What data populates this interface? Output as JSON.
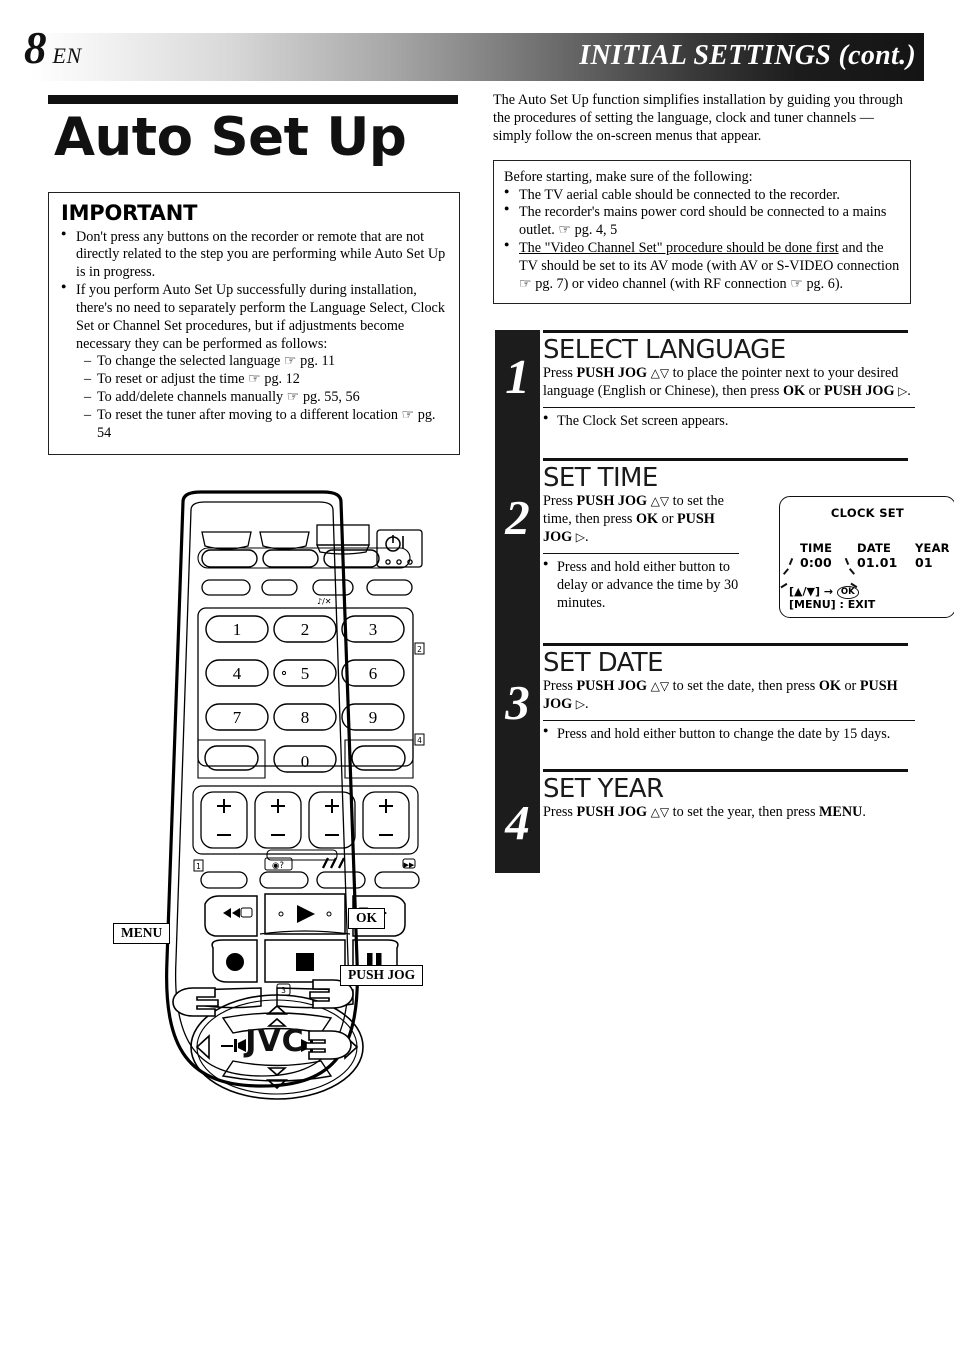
{
  "header": {
    "page_number": "8",
    "language_code": "EN",
    "title": "INITIAL SETTINGS (cont.)"
  },
  "left": {
    "doc_title": "Auto Set Up",
    "important": {
      "heading": "IMPORTANT",
      "bullets": [
        "Don't press any buttons on the recorder or remote that are not directly related to the step you are performing while Auto Set Up is in progress.",
        "If you perform Auto Set Up successfully during installation, there's no need to separately perform the Language Select, Clock Set or Channel Set procedures, but if adjustments become necessary they can be performed as follows:"
      ],
      "sub_items": [
        "To change the selected language ☞ pg. 11",
        "To reset or adjust the time ☞ pg. 12",
        "To add/delete channels manually ☞ pg. 55, 56",
        "To reset the tuner after moving to a different location ☞ pg. 54"
      ]
    },
    "remote": {
      "brand": "JVC",
      "callouts": {
        "menu": "MENU",
        "ok": "OK",
        "push_jog": "PUSH JOG"
      },
      "keypad": [
        "1",
        "2",
        "3",
        "4",
        "5",
        "6",
        "7",
        "8",
        "9",
        "0"
      ]
    }
  },
  "right": {
    "intro": "The Auto Set Up function simplifies installation by guiding you through the procedures of setting the language, clock and tuner channels — simply follow the on-screen menus that appear.",
    "before_box": {
      "lead": "Before starting, make sure of the following:",
      "bullets": [
        "The TV aerial cable should be connected to the recorder.",
        "The recorder's mains power cord should be connected to a mains outlet. ☞ pg. 4, 5",
        "The \"Video Channel Set\" procedure should be done first and the TV should be set to its AV mode (with AV or S-VIDEO connection ☞ pg. 7) or video channel (with RF connection ☞ pg. 6)."
      ],
      "underlined_phrase": "The \"Video Channel Set\" procedure should be done first"
    },
    "steps": [
      {
        "number": "1",
        "title": "SELECT LANGUAGE",
        "text": "Press PUSH JOG △▽ to place the pointer next to your desired language (English or Chinese), then press OK or PUSH JOG ▷.",
        "note": "The Clock Set screen appears."
      },
      {
        "number": "2",
        "title": "SET TIME",
        "text": "Press PUSH JOG △▽ to set the time, then press OK or PUSH JOG ▷.",
        "note": "Press and hold either button to delay or advance the time by 30 minutes."
      },
      {
        "number": "3",
        "title": "SET DATE",
        "text": "Press PUSH JOG △▽ to set the date, then press OK or PUSH JOG ▷.",
        "note": "Press and hold either button to change the date by 15 days."
      },
      {
        "number": "4",
        "title": "SET YEAR",
        "text": "Press PUSH JOG △▽ to set the year, then press MENU.",
        "note": ""
      }
    ],
    "osd": {
      "title": "CLOCK SET",
      "time_label": "TIME",
      "time_value": "0:00",
      "date_label": "DATE",
      "date_value": "01.01",
      "year_label": "YEAR",
      "year_value": "01",
      "hint_keys": "[▲/▼] →",
      "hint_ok": "OK",
      "hint_exit": "[MENU] : EXIT"
    }
  },
  "colors": {
    "ink": "#111111",
    "bar": "#1c1c1c",
    "paper": "#ffffff"
  }
}
